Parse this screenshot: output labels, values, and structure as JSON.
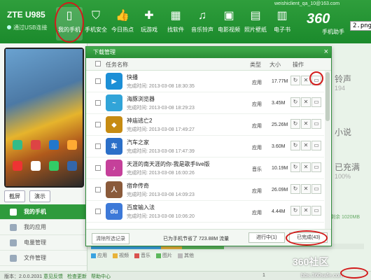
{
  "header": {
    "device_name": "ZTE U985",
    "usb_status": "通过USB连接",
    "account": "weishiclient_qa_10@163.com",
    "logo": "360",
    "logo_sub": "手机助手",
    "png_tag": "2.png",
    "toolbar": [
      {
        "label": "我的手机",
        "icon": "phone-icon"
      },
      {
        "label": "手机安全",
        "icon": "shield-icon"
      },
      {
        "label": "今日热点",
        "icon": "thumb-icon"
      },
      {
        "label": "玩游戏",
        "icon": "gamepad-icon"
      },
      {
        "label": "找软件",
        "icon": "apps-icon"
      },
      {
        "label": "音乐铃声",
        "icon": "music-icon"
      },
      {
        "label": "电影视频",
        "icon": "video-icon"
      },
      {
        "label": "照片壁纸",
        "icon": "picture-icon"
      },
      {
        "label": "电子书",
        "icon": "book-icon"
      }
    ]
  },
  "phone": {
    "btn_screenshot": "截屏",
    "btn_demo": "演示"
  },
  "nav": [
    {
      "label": "我的手机",
      "active": true
    },
    {
      "label": "我的应用",
      "active": false
    },
    {
      "label": "电量管理",
      "active": false
    },
    {
      "label": "文件管理",
      "active": false
    }
  ],
  "dialog": {
    "title": "下载管理",
    "close": "×",
    "col_name": "任务名称",
    "col_type": "类型",
    "col_size": "大小",
    "col_action": "操作",
    "tasks": [
      {
        "name": "快播",
        "time": "完成时间: 2013-03-08 18:30:35",
        "type": "应用",
        "size": "17.77M",
        "color": "#1c8fd6",
        "glyph": "▶"
      },
      {
        "name": "海豚浏览器",
        "time": "完成时间: 2013-03-08 18:29:23",
        "type": "应用",
        "size": "3.45M",
        "color": "#31a4d8",
        "glyph": "~"
      },
      {
        "name": "神庙逃亡2",
        "time": "完成时间: 2013-03-08 17:49:27",
        "type": "应用",
        "size": "25.26M",
        "color": "#c68b12",
        "glyph": "◆"
      },
      {
        "name": "汽车之家",
        "time": "完成时间: 2013-03-08 17:47:39",
        "type": "应用",
        "size": "3.60M",
        "color": "#2b6fc8",
        "glyph": "车"
      },
      {
        "name": "天涯的南天涯的你-我是歌手live版",
        "time": "完成时间: 2013-03-08 16:00:26",
        "type": "音乐",
        "size": "10.19M",
        "color": "#c5409a",
        "glyph": "♪"
      },
      {
        "name": "宿命传奇",
        "time": "完成时间: 2013-03-08 14:09:23",
        "type": "应用",
        "size": "26.09M",
        "color": "#8a5a3a",
        "glyph": "人"
      },
      {
        "name": "百度输入法",
        "time": "完成时间: 2013-03-08 10:06:20",
        "type": "应用",
        "size": "4.44M",
        "color": "#3d79d8",
        "glyph": "du"
      }
    ],
    "clear_btn": "清除所选记录",
    "saved_text": "已为手机节省了 723.88M 流量",
    "tab_in_progress": "进行中(1)",
    "tab_done": "已完成(43)"
  },
  "background": {
    "cat_ringtone": "铃声",
    "cat_ringtone_num": "194",
    "cat_novel": "小说",
    "cat_charged": "已充满",
    "cat_charged_num": "100%",
    "storage": "剩余 1020MB"
  },
  "storage_legend": [
    "应用",
    "视频",
    "音乐",
    "图片",
    "其他"
  ],
  "storage_colors": [
    "#3aa3e0",
    "#e8b33a",
    "#d9534f",
    "#5cb85c",
    "#bbbbbb"
  ],
  "status": {
    "version": "版本：2.0.0.2031",
    "feedback": "意见反馈",
    "check_update": "检查更新",
    "help": "帮助中心",
    "page_num": "1"
  },
  "watermark": {
    "name": "360社区",
    "url": "bbs.360safe.com"
  }
}
